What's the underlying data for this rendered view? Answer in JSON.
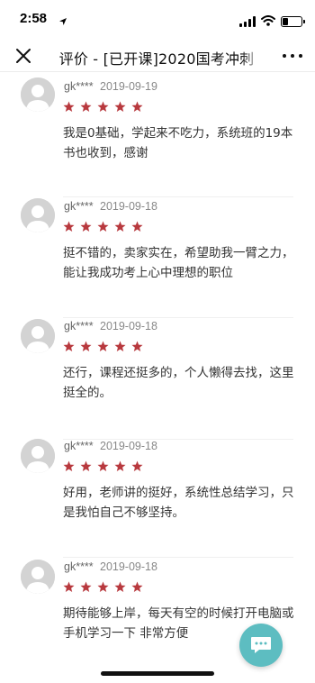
{
  "status_bar": {
    "time": "2:58",
    "battery_level": 0.3
  },
  "nav": {
    "title": "评价 - [已开课]2020国考冲刺"
  },
  "theme": {
    "star_color": "#b8393e",
    "fab_color": "#5dbdc1"
  },
  "reviews": [
    {
      "user": "gk****",
      "date": "2019-09-19",
      "rating": 5,
      "text": "我是0基础，学起来不吃力，系统班的19本书也收到，感谢"
    },
    {
      "user": "gk****",
      "date": "2019-09-18",
      "rating": 5,
      "text": "挺不错的，卖家实在，希望助我一臂之力，能让我成功考上心中理想的职位"
    },
    {
      "user": "gk****",
      "date": "2019-09-18",
      "rating": 5,
      "text": "还行，课程还挺多的，个人懒得去找，这里挺全的。"
    },
    {
      "user": "gk****",
      "date": "2019-09-18",
      "rating": 5,
      "text": "好用，老师讲的挺好，系统性总结学习，只是我怕自己不够坚持。"
    },
    {
      "user": "gk****",
      "date": "2019-09-18",
      "rating": 5,
      "text": "期待能够上岸，每天有空的时候打开电脑或手机学习一下 非常方便"
    }
  ]
}
